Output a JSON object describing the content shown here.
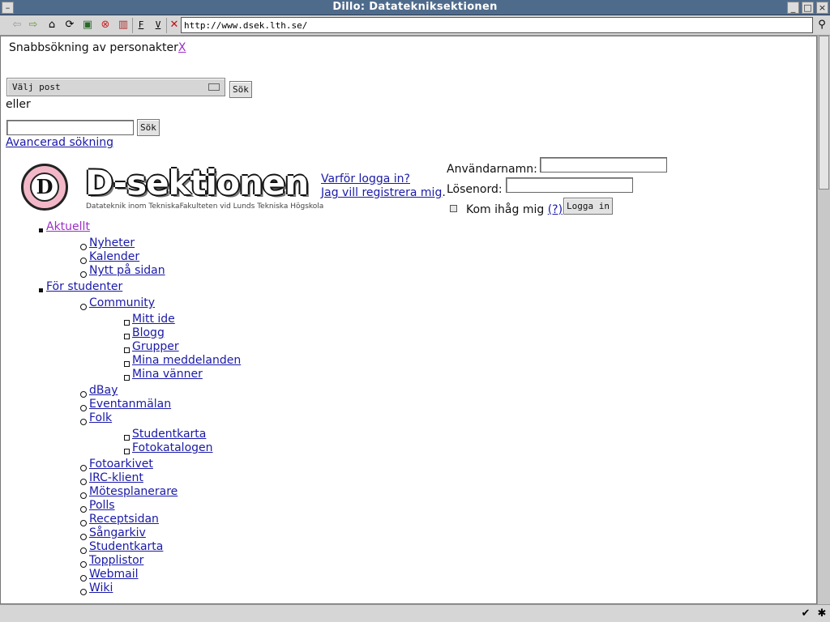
{
  "window": {
    "title": "Dillo: Datateknik­sektionen"
  },
  "toolbar": {
    "url": "http://www.dsek.lth.se/",
    "buttons": [
      "back-icon",
      "forward-icon",
      "home-icon",
      "reload-icon",
      "save-icon",
      "stop-icon",
      "bookmarks-icon"
    ],
    "f_label": "F",
    "v_label": "V"
  },
  "quicksearch": {
    "heading": "Snabbsökning av personakter",
    "close_link": "X",
    "select_value": "Välj post",
    "search_button": "Sök",
    "or_text": "eller",
    "search_button2": "Sök",
    "advanced_link": "Avancerad sökning"
  },
  "logo": {
    "wordmark": "D-sektionen",
    "tagline": "Datateknik inom TekniskaFakulteten vid Lunds Tekniska Högskola",
    "letter": "D"
  },
  "links": {
    "why_login": "Varför logga in?",
    "register": "Jag vill registrera mig",
    "register_suffix": "."
  },
  "login": {
    "username_label": "Användarnamn:",
    "password_label": "Lösenord:",
    "remember_label": "Kom ihåg mig",
    "help_link": "(?)",
    "login_button": "Logga in"
  },
  "nav": [
    {
      "level": 1,
      "label": "Aktuellt",
      "visited": true
    },
    {
      "level": 2,
      "label": "Nyheter"
    },
    {
      "level": 2,
      "label": "Kalender"
    },
    {
      "level": 2,
      "label": "Nytt på sidan"
    },
    {
      "level": 1,
      "label": "För studenter"
    },
    {
      "level": 2,
      "label": "Community"
    },
    {
      "level": 3,
      "label": "Mitt ide"
    },
    {
      "level": 3,
      "label": "Blogg"
    },
    {
      "level": 3,
      "label": "Grupper"
    },
    {
      "level": 3,
      "label": "Mina meddelanden"
    },
    {
      "level": 3,
      "label": "Mina vänner"
    },
    {
      "level": 2,
      "label": "dBay"
    },
    {
      "level": 2,
      "label": "Eventanmälan"
    },
    {
      "level": 2,
      "label": "Folk"
    },
    {
      "level": 3,
      "label": "Studentkarta"
    },
    {
      "level": 3,
      "label": "Fotokatalogen"
    },
    {
      "level": 2,
      "label": "Fotoarkivet"
    },
    {
      "level": 2,
      "label": "IRC-klient"
    },
    {
      "level": 2,
      "label": "Mötesplanerare"
    },
    {
      "level": 2,
      "label": "Polls"
    },
    {
      "level": 2,
      "label": "Receptsidan"
    },
    {
      "level": 2,
      "label": "Sångarkiv"
    },
    {
      "level": 2,
      "label": "Studentkarta"
    },
    {
      "level": 2,
      "label": "Topplistor"
    },
    {
      "level": 2,
      "label": "Webmail"
    },
    {
      "level": 2,
      "label": "Wiki"
    }
  ]
}
